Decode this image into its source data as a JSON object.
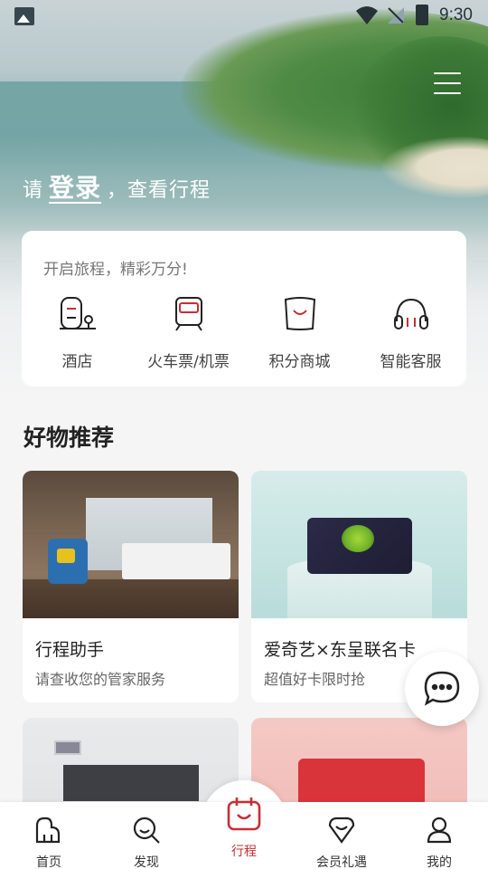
{
  "status_bar": {
    "time": "9:30"
  },
  "hero": {
    "login_prefix": "请",
    "login_link": "登录",
    "login_suffix": "，查看行程"
  },
  "service_card": {
    "tagline": "开启旅程，精彩万分!",
    "items": [
      {
        "label": "酒店",
        "icon": "hotel-icon"
      },
      {
        "label": "火车票/机票",
        "icon": "train-icon"
      },
      {
        "label": "积分商城",
        "icon": "shopping-bag-icon"
      },
      {
        "label": "智能客服",
        "icon": "headset-icon"
      }
    ]
  },
  "recommend": {
    "title": "好物推荐",
    "products": [
      {
        "title": "行程助手",
        "subtitle": "请查收您的管家服务"
      },
      {
        "title": "爱奇艺×东呈联名卡",
        "subtitle": "超值好卡限时抢"
      },
      {
        "title": "",
        "subtitle": ""
      },
      {
        "title": "",
        "subtitle": ""
      }
    ]
  },
  "tabbar": {
    "tabs": [
      {
        "label": "首页",
        "icon": "home-icon"
      },
      {
        "label": "发现",
        "icon": "discover-icon"
      },
      {
        "label": "行程",
        "icon": "calendar-icon",
        "active": true
      },
      {
        "label": "会员礼遇",
        "icon": "member-icon"
      },
      {
        "label": "我的",
        "icon": "profile-icon"
      }
    ]
  },
  "colors": {
    "accent": "#c62f34"
  }
}
